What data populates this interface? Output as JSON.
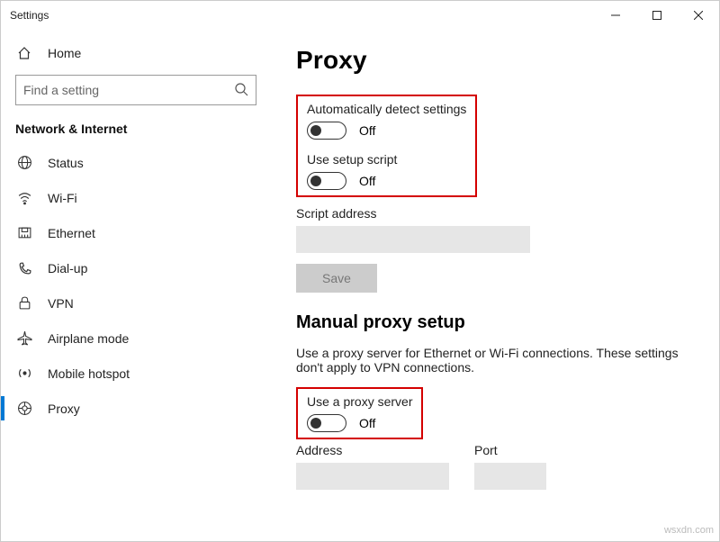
{
  "window": {
    "title": "Settings"
  },
  "sidebar": {
    "home": "Home",
    "search_placeholder": "Find a setting",
    "section": "Network & Internet",
    "items": [
      {
        "label": "Status"
      },
      {
        "label": "Wi-Fi"
      },
      {
        "label": "Ethernet"
      },
      {
        "label": "Dial-up"
      },
      {
        "label": "VPN"
      },
      {
        "label": "Airplane mode"
      },
      {
        "label": "Mobile hotspot"
      },
      {
        "label": "Proxy"
      }
    ]
  },
  "page": {
    "title": "Proxy",
    "auto_detect_label": "Automatically detect settings",
    "auto_detect_state": "Off",
    "setup_script_label": "Use setup script",
    "setup_script_state": "Off",
    "script_address_label": "Script address",
    "script_address_value": "",
    "save_label": "Save",
    "manual_heading": "Manual proxy setup",
    "manual_desc": "Use a proxy server for Ethernet or Wi-Fi connections. These settings don't apply to VPN connections.",
    "use_proxy_label": "Use a proxy server",
    "use_proxy_state": "Off",
    "address_label": "Address",
    "address_value": "",
    "port_label": "Port",
    "port_value": ""
  },
  "watermark": "wsxdn.com"
}
